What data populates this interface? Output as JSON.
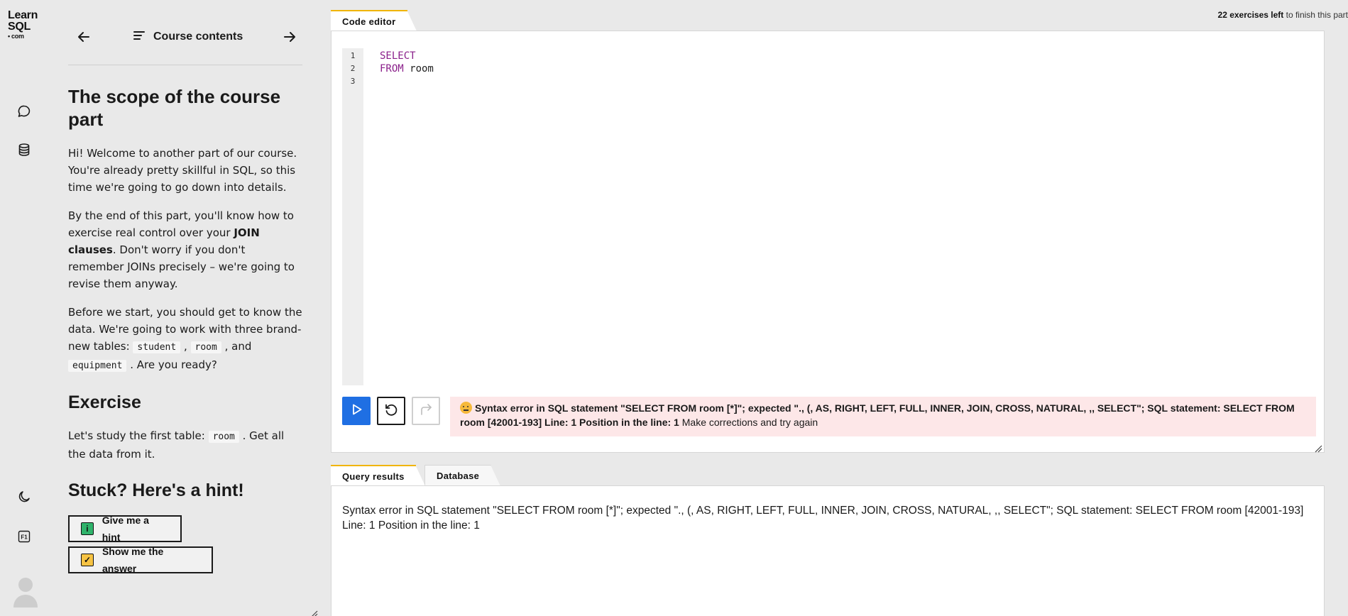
{
  "logo": {
    "line1": "Learn",
    "line2": "SQL",
    "line3": "• com"
  },
  "nav": {
    "contents_label": "Course contents"
  },
  "lesson": {
    "title": "The scope of the course part",
    "p1": "Hi! Welcome to another part of our course. You're already pretty skillful in SQL, so this time we're going to go down into details.",
    "p2_before": "By the end of this part, you'll know how to exercise real control over your ",
    "p2_bold": "JOIN clauses",
    "p2_after": ". Don't worry if you don't remember JOINs precisely – we're going to revise them anyway.",
    "p3_before": "Before we start, you should get to know the data. We're going to work with three brand-new tables: ",
    "table1": "student",
    "sep1": " , ",
    "table2": "room",
    "sep2": " , and ",
    "table3": "equipment",
    "p3_after": " . Are you ready?"
  },
  "exercise": {
    "heading": "Exercise",
    "text_before": "Let's study the first table: ",
    "table": "room",
    "text_after": " . Get all the data from it."
  },
  "hint": {
    "heading": "Stuck? Here's a hint!",
    "hint_button": "Give me a hint",
    "answer_button": "Show me the answer"
  },
  "progress": {
    "count": "22 exercises left",
    "suffix": " to finish this part"
  },
  "editor": {
    "tab_label": "Code editor",
    "line_numbers": [
      "1",
      "2",
      "3"
    ],
    "line1_kw": "SELECT",
    "line2_kw": "FROM",
    "line2_rest": " room"
  },
  "error": {
    "bold": "Syntax error in SQL statement \"SELECT FROM room [*]\"; expected \"., (, AS, RIGHT, LEFT, FULL, INNER, JOIN, CROSS, NATURAL, ,, SELECT\"; SQL statement: SELECT FROM room [42001-193] Line: 1 Position in the line: 1",
    "rest": " Make corrections and try again"
  },
  "results": {
    "tab_results": "Query results",
    "tab_database": "Database",
    "message": "Syntax error in SQL statement \"SELECT FROM room [*]\"; expected \"., (, AS, RIGHT, LEFT, FULL, INNER, JOIN, CROSS, NATURAL, ,, SELECT\"; SQL statement: SELECT FROM room [42001-193] Line: 1 Position in the line: 1"
  },
  "colors": {
    "accent_yellow": "#f0b400",
    "run_blue": "#1f6fe3",
    "error_bg": "#fde7e8",
    "keyword": "#8a1f8a"
  },
  "icons": [
    "arrow-left-icon",
    "list-icon",
    "arrow-right-icon",
    "chat-icon",
    "database-icon",
    "moon-icon",
    "f1-key-icon",
    "avatar-icon",
    "play-icon",
    "reset-icon",
    "redo-icon",
    "info-icon",
    "check-icon",
    "resize-handle-icon",
    "confused-face-icon"
  ]
}
